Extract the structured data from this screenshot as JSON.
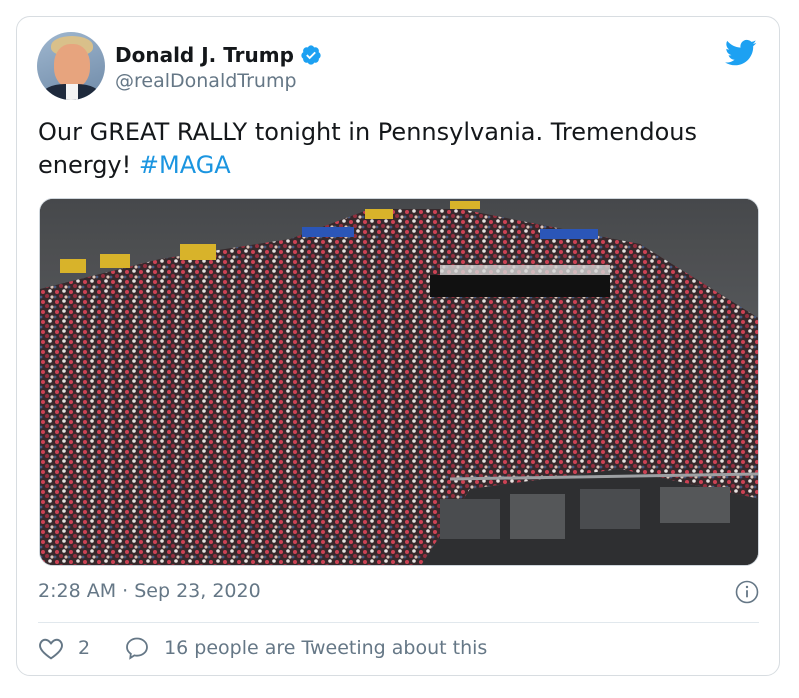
{
  "tweet": {
    "author_name": "Donald J. Trump",
    "author_handle": "@realDonaldTrump",
    "text_main": "Our GREAT RALLY tonight in Pennsylvania. Tremendous energy! ",
    "hashtag": "#MAGA",
    "timestamp": "2:28 AM · Sep 23, 2020",
    "like_count": "2",
    "tweeting_text": "16 people are Tweeting about this",
    "media_description": "rally-crowd-photo"
  },
  "icons": {
    "verified": "verified-badge-icon",
    "twitter_logo": "twitter-bird-icon",
    "info": "info-icon",
    "like": "heart-icon",
    "reply": "speech-bubble-icon"
  },
  "colors": {
    "accent": "#1b95e0",
    "secondary_text": "#657786",
    "primary_text": "#14171a",
    "border": "#d8dde1"
  }
}
